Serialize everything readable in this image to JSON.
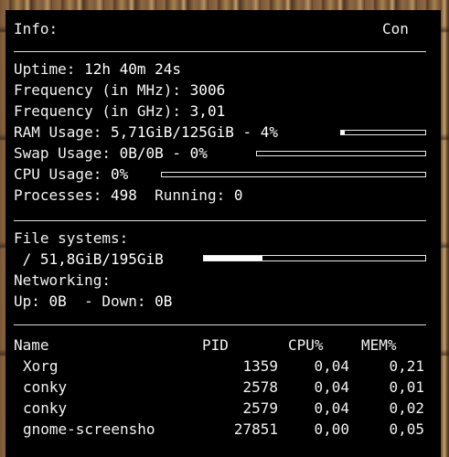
{
  "header": {
    "info_label": "Info:",
    "con_label": "Con"
  },
  "system": {
    "uptime_label": "Uptime:",
    "uptime_value": "12h 40m 24s",
    "freq_mhz_label": "Frequency (in MHz):",
    "freq_mhz_value": "3006",
    "freq_ghz_label": "Frequency (in GHz):",
    "freq_ghz_value": "3,01",
    "ram_label": "RAM Usage:",
    "ram_value": "5,71GiB/125GiB - 4%",
    "ram_percent": 4,
    "swap_label": "Swap Usage:",
    "swap_value": "0B/0B - 0%",
    "swap_percent": 0,
    "cpu_label": "CPU Usage:",
    "cpu_value": "0%",
    "cpu_percent": 0,
    "processes_label": "Processes:",
    "processes_value": "498",
    "running_label": "Running:",
    "running_value": "0"
  },
  "filesystems": {
    "title": "File systems:",
    "root_label": "/ 51,8GiB/195GiB",
    "root_percent": 26.6
  },
  "network": {
    "title": "Networking:",
    "up_label": "Up:",
    "up_value": "0B",
    "down_label": "- Down:",
    "down_value": "0B"
  },
  "processes": {
    "headers": {
      "name": "Name",
      "pid": "PID",
      "cpu": "CPU%",
      "mem": "MEM%"
    },
    "rows": [
      {
        "name": "Xorg",
        "pid": "1359",
        "cpu": "0,04",
        "mem": "0,21"
      },
      {
        "name": "conky",
        "pid": "2578",
        "cpu": "0,04",
        "mem": "0,01"
      },
      {
        "name": "conky",
        "pid": "2579",
        "cpu": "0,04",
        "mem": "0,02"
      },
      {
        "name": "gnome-screensho",
        "pid": "27851",
        "cpu": "0,00",
        "mem": "0,05"
      }
    ]
  }
}
